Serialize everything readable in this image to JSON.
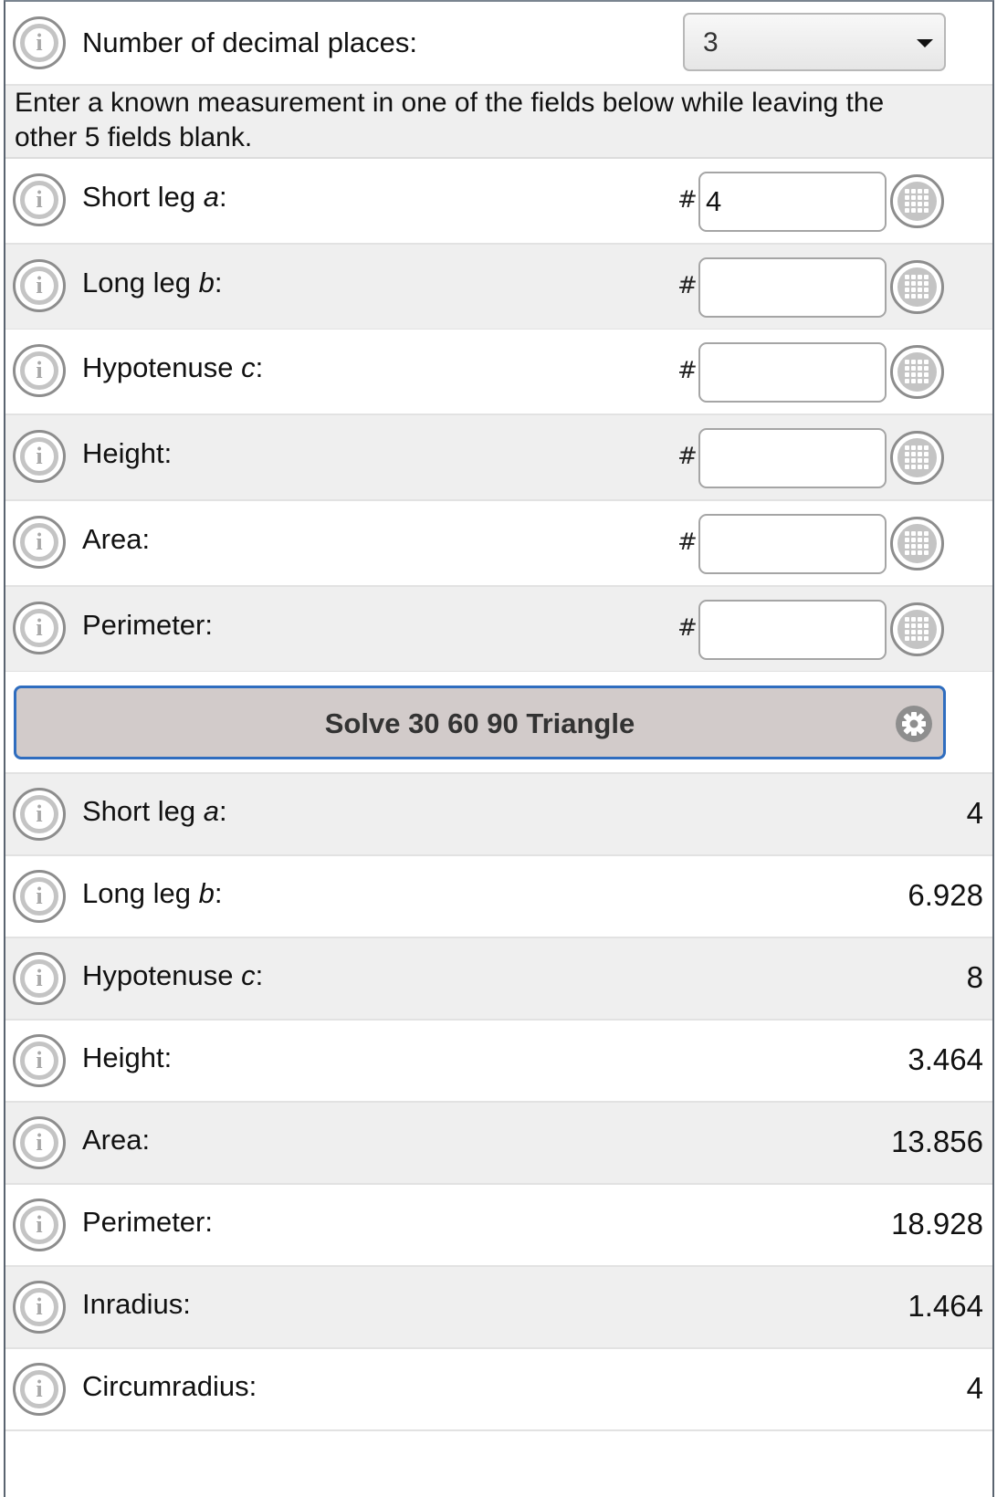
{
  "settings": {
    "decimal_label": "Number of decimal places:",
    "decimal_value": "3"
  },
  "instructions": "Enter a known measurement in one of the fields below while leaving the other 5 fields blank.",
  "inputs": [
    {
      "label": "Short leg ",
      "var": "a",
      "suffix": ":",
      "value": "4"
    },
    {
      "label": "Long leg ",
      "var": "b",
      "suffix": ":",
      "value": ""
    },
    {
      "label": "Hypotenuse ",
      "var": "c",
      "suffix": ":",
      "value": ""
    },
    {
      "label": "Height:",
      "var": "",
      "suffix": "",
      "value": ""
    },
    {
      "label": "Area:",
      "var": "",
      "suffix": "",
      "value": ""
    },
    {
      "label": "Perimeter:",
      "var": "",
      "suffix": "",
      "value": ""
    }
  ],
  "hash_symbol": "#",
  "info_glyph": "i",
  "solve_button": "Solve 30 60 90 Triangle",
  "results": [
    {
      "label": "Short leg ",
      "var": "a",
      "suffix": ":",
      "value": "4"
    },
    {
      "label": "Long leg ",
      "var": "b",
      "suffix": ":",
      "value": "6.928"
    },
    {
      "label": "Hypotenuse ",
      "var": "c",
      "suffix": ":",
      "value": "8"
    },
    {
      "label": "Height:",
      "var": "",
      "suffix": "",
      "value": "3.464"
    },
    {
      "label": "Area:",
      "var": "",
      "suffix": "",
      "value": "13.856"
    },
    {
      "label": "Perimeter:",
      "var": "",
      "suffix": "",
      "value": "18.928"
    },
    {
      "label": "Inradius:",
      "var": "",
      "suffix": "",
      "value": "1.464"
    },
    {
      "label": "Circumradius:",
      "var": "",
      "suffix": "",
      "value": "4"
    }
  ],
  "icons": {
    "info": "info-icon",
    "keypad": "keypad-icon",
    "gear": "gear-icon",
    "dropdown": "chevron-down-icon"
  },
  "colors": {
    "button_border": "#2f6dbf",
    "button_bg": "#d2cbca",
    "row_alt": "#efefef"
  }
}
